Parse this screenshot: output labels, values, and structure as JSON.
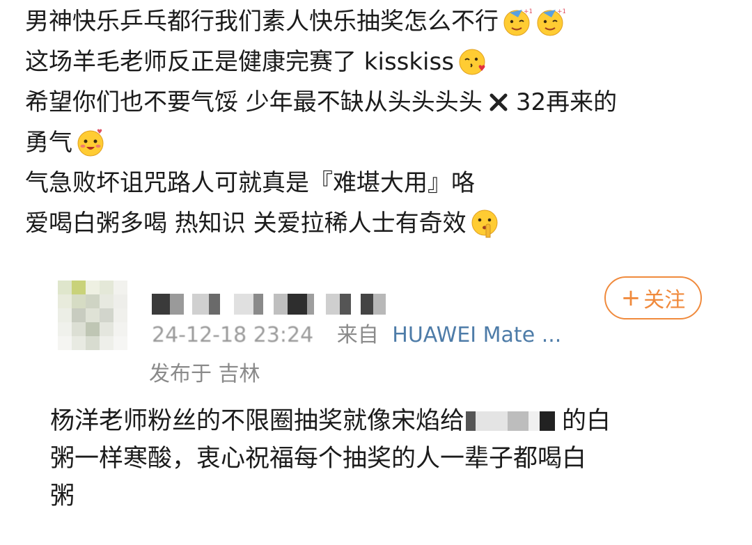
{
  "post": {
    "lines": [
      "男神快乐乒乓都行我们素人快乐抽奖怎么不行",
      "这场羊毛老师反正是健康完赛了 kisskiss",
      "希望你们也不要气馁  少年最不缺从头头头头",
      "32再来的",
      "勇气",
      "气急败坏诅咒路人可就真是『难堪大用』咯",
      "爱喝白粥多喝  热知识  关爱拉稀人士有奇效"
    ],
    "emoji": {
      "partying": "partying-face-icon",
      "kiss": "kissing-face-icon",
      "smile": "smiling-face-icon",
      "thinking": "shushing-face-icon",
      "cross": "cross-mark-icon"
    }
  },
  "card": {
    "meta_date": "24-12-18 23:24",
    "meta_from": "来自",
    "meta_device": "HUAWEI Mate ...",
    "location": "发布于 吉林",
    "follow_label": "关注",
    "follow_plus": "+",
    "body_lines": [
      "杨洋老师粉丝的不限圈抽奖就像宋焰给",
      "的白",
      "粥一样寒酸，衷心祝福每个抽奖的人一辈子都喝白",
      "粥"
    ]
  },
  "colors": {
    "accent": "#f08a3c",
    "device_link": "#4e7ca8",
    "meta_gray": "#8a8a8a",
    "text": "#1b1b1b"
  }
}
